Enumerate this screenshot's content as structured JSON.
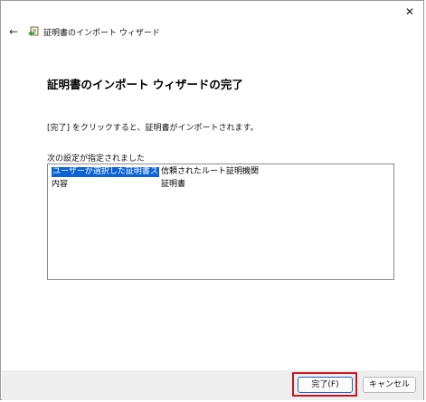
{
  "window": {
    "close_glyph": "✕",
    "back_glyph": "←",
    "title": "証明書のインポート ウィザード"
  },
  "main": {
    "heading": "証明書のインポート ウィザードの完了",
    "instruction": "[完了] をクリックすると、証明書がインポートされます。",
    "settings_label": "次の設定が指定されました",
    "settings": [
      {
        "name": "ユーザーが選択した証明書ストア",
        "value": "信頼されたルート証明機関",
        "selected": true
      },
      {
        "name": "内容",
        "value": "証明書",
        "selected": false
      }
    ]
  },
  "footer": {
    "finish_label": "完了(F)",
    "cancel_label": "キャンセル"
  },
  "colors": {
    "selection": "#0a64d6",
    "highlight_box": "#d0121b"
  },
  "icons": {
    "back": "back-arrow-icon",
    "wizard": "certificate-wizard-icon",
    "close": "close-icon"
  }
}
